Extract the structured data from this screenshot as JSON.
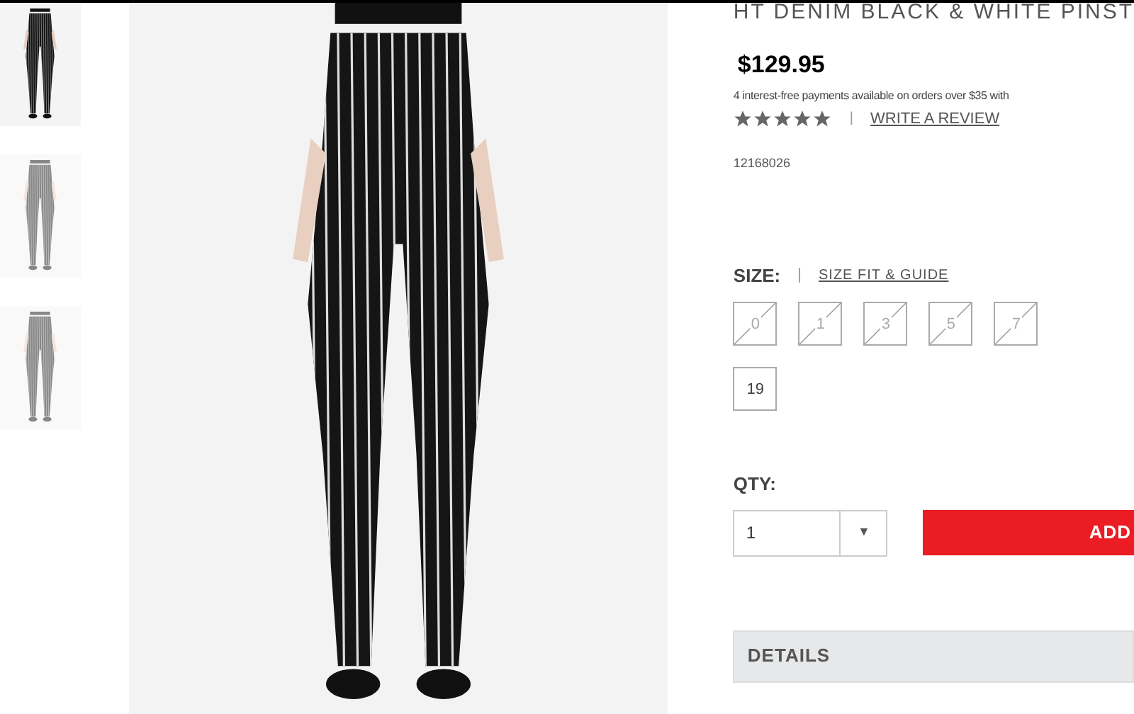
{
  "thumbnails": [
    {
      "selected": true
    },
    {
      "selected": false
    },
    {
      "selected": false
    }
  ],
  "product": {
    "title": "HT DENIM BLACK & WHITE PINST",
    "price": "$129.95",
    "payments_note": "4 interest-free payments available on orders over $35 with",
    "stars": 5,
    "separator": "|",
    "review_link": "WRITE A REVIEW",
    "sku": "12168026"
  },
  "size": {
    "label": "SIZE:",
    "separator": "|",
    "guide_link": "SIZE FIT & GUIDE",
    "options": [
      {
        "label": "0",
        "available": false
      },
      {
        "label": "1",
        "available": false
      },
      {
        "label": "3",
        "available": false
      },
      {
        "label": "5",
        "available": false
      },
      {
        "label": "7",
        "available": false
      },
      {
        "label": "19",
        "available": true
      }
    ]
  },
  "quantity": {
    "label": "QTY:",
    "value": "1",
    "dropdown_arrow": "▼"
  },
  "add_button": "ADD",
  "details": {
    "label": "DETAILS"
  }
}
